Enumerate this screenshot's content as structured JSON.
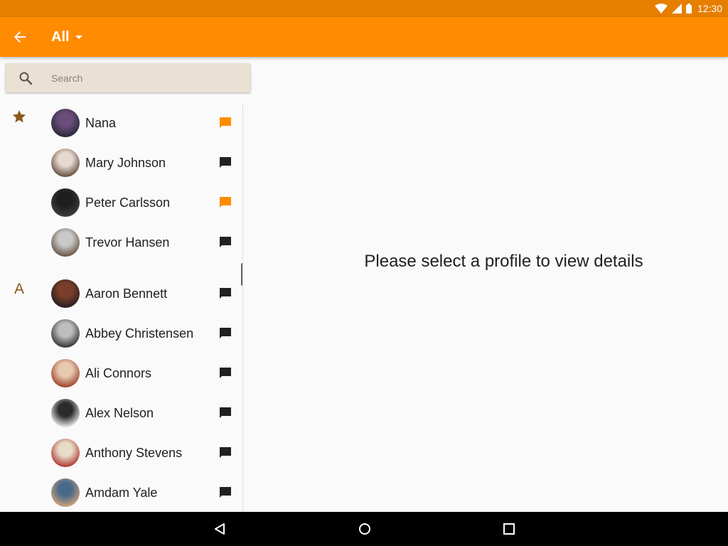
{
  "status_bar": {
    "time": "12:30"
  },
  "app_bar": {
    "filter_label": "All"
  },
  "search": {
    "placeholder": "Search"
  },
  "favorites": [
    {
      "name": "Nana",
      "avatar_colors": [
        "#6a4d7a",
        "#2a2a3a"
      ],
      "message_color": "#ff8c00"
    },
    {
      "name": "Mary Johnson",
      "avatar_colors": [
        "#e6d9cf",
        "#6b5548"
      ],
      "message_color": "#212121"
    },
    {
      "name": "Peter Carlsson",
      "avatar_colors": [
        "#1e1e1e",
        "#3c3c3c"
      ],
      "message_color": "#ff8c00"
    },
    {
      "name": "Trevor Hansen",
      "avatar_colors": [
        "#c9c9c9",
        "#6e5a4a"
      ],
      "message_color": "#212121"
    }
  ],
  "section_a": {
    "letter": "A",
    "contacts": [
      {
        "name": "Aaron Bennett",
        "avatar_colors": [
          "#7a3e2a",
          "#2a2020"
        ],
        "message_color": "#212121"
      },
      {
        "name": "Abbey Christensen",
        "avatar_colors": [
          "#bdbdbd",
          "#3a3a3a"
        ],
        "message_color": "#212121"
      },
      {
        "name": "Ali Connors",
        "avatar_colors": [
          "#e7c9b0",
          "#a14a34"
        ],
        "message_color": "#212121"
      },
      {
        "name": "Alex Nelson",
        "avatar_colors": [
          "#2b2b2b",
          "#e0e0e0"
        ],
        "message_color": "#212121"
      },
      {
        "name": "Anthony Stevens",
        "avatar_colors": [
          "#e8dcc8",
          "#b0403a"
        ],
        "message_color": "#212121"
      },
      {
        "name": "Amdam Yale",
        "avatar_colors": [
          "#4a6a8a",
          "#c9a07a"
        ],
        "message_color": "#212121"
      }
    ]
  },
  "detail": {
    "empty_message": "Please select a profile to view details"
  },
  "colors": {
    "status_bar": "#e67e00",
    "app_bar": "#ff8c00",
    "search_bg": "#e9e1d4",
    "section_marker": "#8a5a1c"
  }
}
